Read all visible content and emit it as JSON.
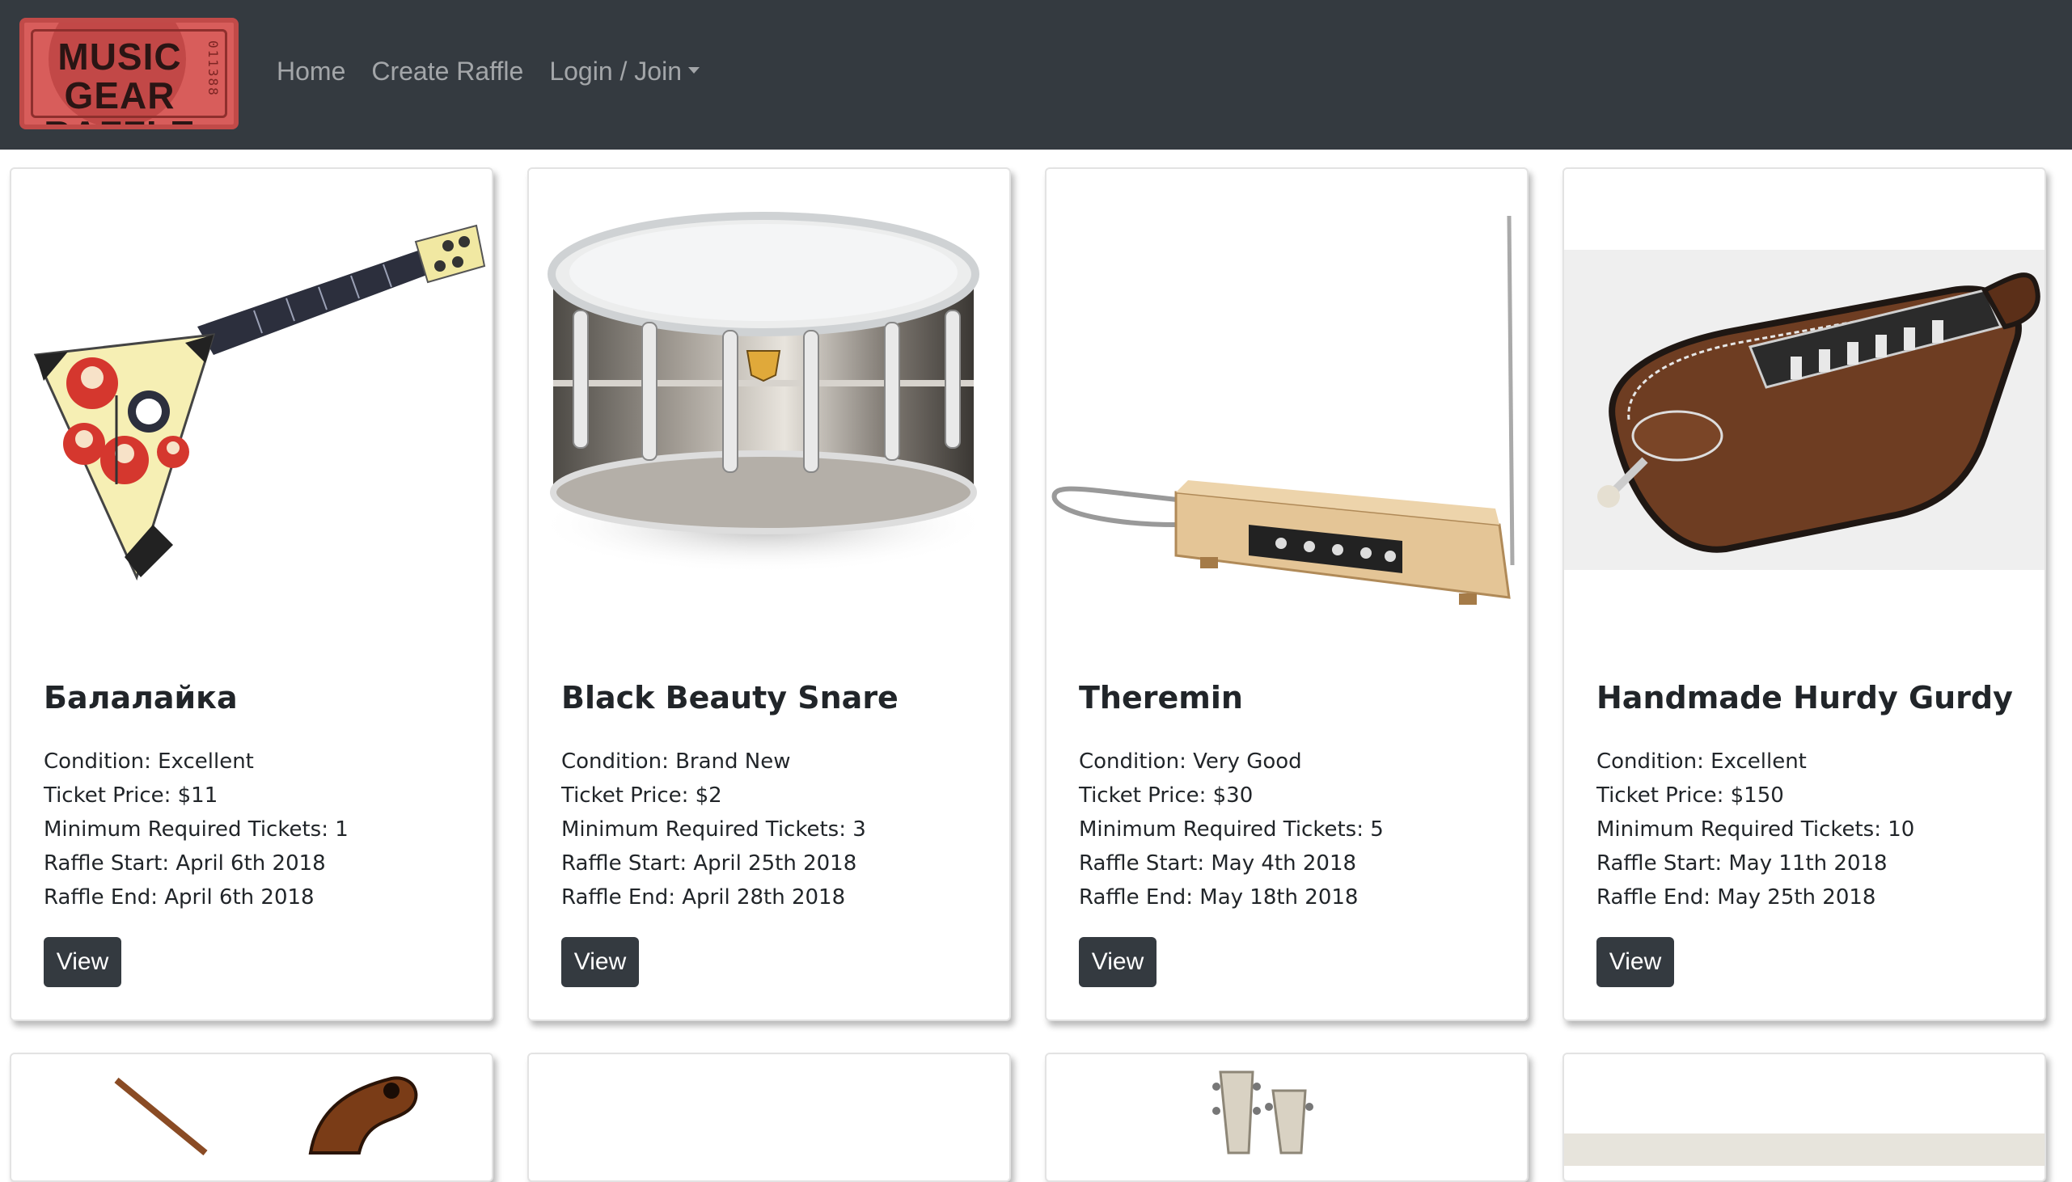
{
  "navbar": {
    "logo": {
      "text_line1": "MUSIC GEAR",
      "text_line2": "RAFFLE",
      "serial": "011388"
    },
    "links": [
      {
        "label": "Home"
      },
      {
        "label": "Create Raffle"
      },
      {
        "label": "Login / Join"
      }
    ]
  },
  "raffles": [
    {
      "title": "Балалайка",
      "condition": "Condition: Excellent",
      "ticket_price": "Ticket Price: $11",
      "min_tickets": "Minimum Required Tickets: 1",
      "start": "Raffle Start: April 6th 2018",
      "end": "Raffle End: April 6th 2018",
      "button": "View",
      "image": "balalaika-image"
    },
    {
      "title": "Black Beauty Snare",
      "condition": "Condition: Brand New",
      "ticket_price": "Ticket Price: $2",
      "min_tickets": "Minimum Required Tickets: 3",
      "start": "Raffle Start: April 25th 2018",
      "end": "Raffle End: April 28th 2018",
      "button": "View",
      "image": "snare-drum-image"
    },
    {
      "title": "Theremin",
      "condition": "Condition: Very Good",
      "ticket_price": "Ticket Price: $30",
      "min_tickets": "Minimum Required Tickets: 5",
      "start": "Raffle Start: May 4th 2018",
      "end": "Raffle End: May 18th 2018",
      "button": "View",
      "image": "theremin-image"
    },
    {
      "title": "Handmade Hurdy Gurdy",
      "condition": "Condition: Excellent",
      "ticket_price": "Ticket Price: $150",
      "min_tickets": "Minimum Required Tickets: 10",
      "start": "Raffle Start: May 11th 2018",
      "end": "Raffle End: May 25th 2018",
      "button": "View",
      "image": "hurdy-gurdy-image"
    }
  ],
  "colors": {
    "navbar_bg": "#343a40",
    "button_bg": "#343a40",
    "logo_red": "#d85d5b"
  }
}
